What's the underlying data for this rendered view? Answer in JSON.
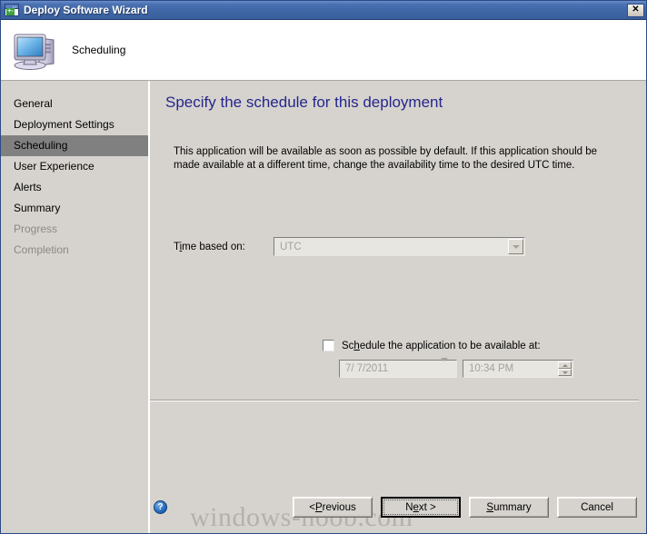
{
  "window": {
    "title": "Deploy Software Wizard",
    "close_label": "✕",
    "icon": "wizard-window-icon"
  },
  "header": {
    "label": "Scheduling",
    "icon": "computer-icon"
  },
  "sidebar": {
    "items": [
      {
        "label": "General",
        "state": "normal"
      },
      {
        "label": "Deployment Settings",
        "state": "normal"
      },
      {
        "label": "Scheduling",
        "state": "selected"
      },
      {
        "label": "User Experience",
        "state": "normal"
      },
      {
        "label": "Alerts",
        "state": "normal"
      },
      {
        "label": "Summary",
        "state": "normal"
      },
      {
        "label": "Progress",
        "state": "disabled"
      },
      {
        "label": "Completion",
        "state": "disabled"
      }
    ]
  },
  "main": {
    "page_title": "Specify the schedule for this deployment",
    "description": "This application will be available as soon as possible by default. If this application should be made available at a different time, change the availability time to the desired UTC time.",
    "time_based_on": {
      "label_pre": "T",
      "label_accel": "i",
      "label_post": "me based on:",
      "value": "UTC",
      "enabled": false
    },
    "schedule_checkbox": {
      "label_pre": "Sc",
      "label_accel": "h",
      "label_post": "edule the application to be available at:",
      "checked": false
    },
    "date_field": {
      "value": "7/ 7/2011",
      "enabled": false
    },
    "time_field": {
      "value": "10:34 PM",
      "enabled": false
    }
  },
  "footer": {
    "help_label": "?",
    "buttons": [
      {
        "pre": "< ",
        "accel": "P",
        "post": "revious",
        "default": false
      },
      {
        "pre": "N",
        "accel": "e",
        "post": "xt >",
        "default": true
      },
      {
        "pre": "",
        "accel": "S",
        "post": "ummary",
        "default": false
      },
      {
        "pre": "Cancel",
        "accel": "",
        "post": "",
        "default": false
      }
    ],
    "watermark": "windows-noob.com"
  },
  "colors": {
    "title_bar": "#3f66a6",
    "face": "#d6d3ce",
    "heading": "#25268c",
    "selection": "#808080",
    "disabled_text": "#8b8984"
  }
}
